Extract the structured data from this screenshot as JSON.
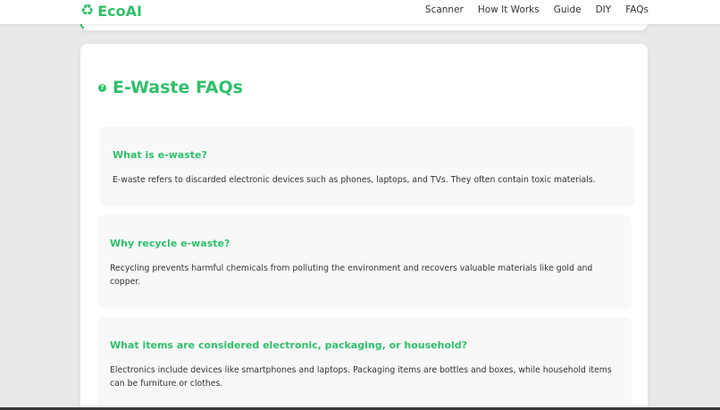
{
  "brand": {
    "name": "EcoAI",
    "icon": "recycle-icon",
    "color": "#2fbf6a"
  },
  "nav": {
    "links": [
      {
        "label": "Scanner"
      },
      {
        "label": "How It Works"
      },
      {
        "label": "Guide"
      },
      {
        "label": "DIY"
      },
      {
        "label": "FAQs"
      }
    ]
  },
  "faq": {
    "title": "E-Waste FAQs",
    "title_icon": "question-circle-icon",
    "items": [
      {
        "question": "What is e-waste?",
        "answer": "E-waste refers to discarded electronic devices such as phones, laptops, and TVs. They often contain toxic materials."
      },
      {
        "question": "Why recycle e-waste?",
        "answer": "Recycling prevents harmful chemicals from polluting the environment and recovers valuable materials like gold and copper."
      },
      {
        "question": "What items are considered electronic, packaging, or household?",
        "answer": "Electronics include devices like smartphones and laptops. Packaging items are bottles and boxes, while household items can be furniture or clothes."
      }
    ]
  },
  "colors": {
    "accent": "#2fbf6a",
    "page_bg": "#e8e9ea",
    "card_bg": "#ffffff",
    "item_bg": "#f8f8f9"
  }
}
